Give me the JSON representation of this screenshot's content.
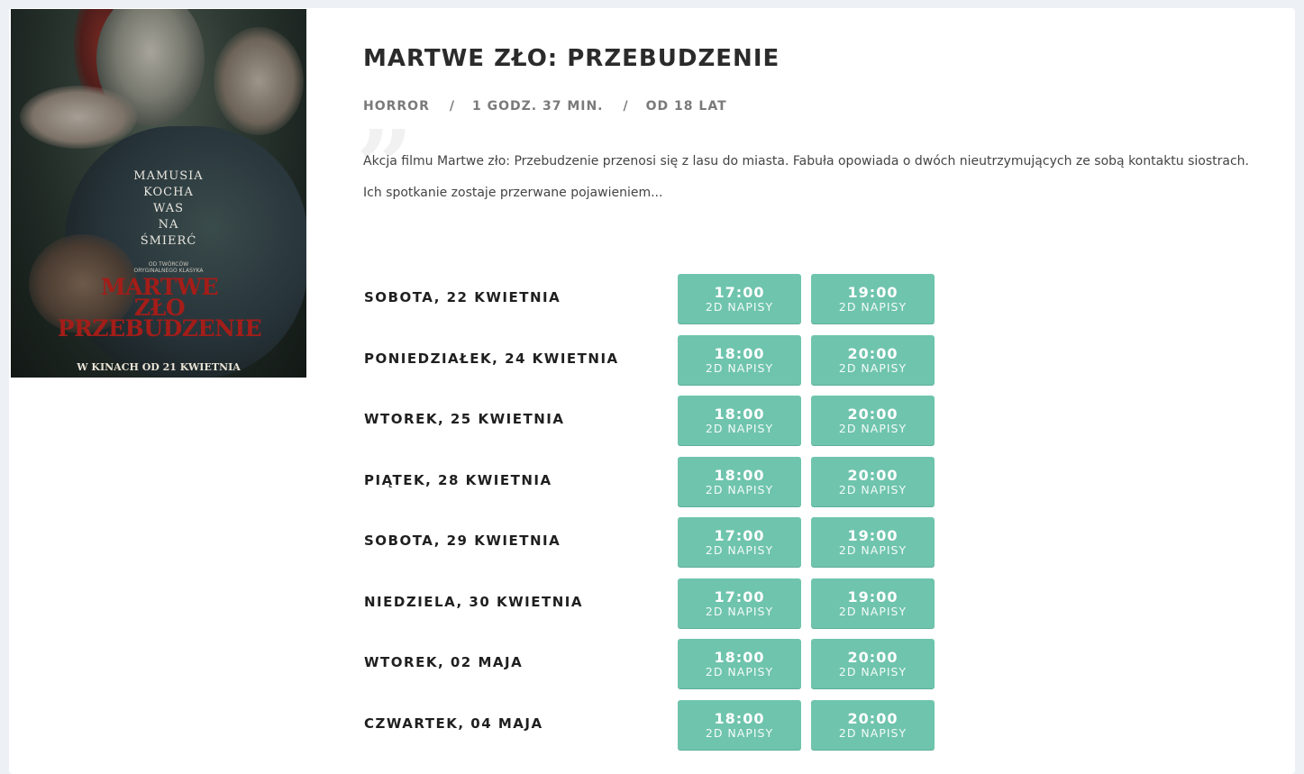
{
  "movie": {
    "title": "MARTWE ZŁO: PRZEBUDZENIE",
    "genre": "HORROR",
    "duration": "1 GODZ. 37 MIN.",
    "age": "OD 18 LAT",
    "separator": "/",
    "quote_mark": "”",
    "description": "Akcja filmu Martwe zło: Przebudzenie przenosi się z lasu do miasta. Fabuła opowiada o dwóch nieutrzymujących ze sobą kontaktu siostrach. Ich spotkanie zostaje przerwane pojawieniem..."
  },
  "poster": {
    "tagline": "MAMUSIA\nKOCHA\nWAS\nNA\nŚMIERĆ",
    "small_text": "OD TWÓRCÓW\nORYGINALNEGO KLASYKA",
    "title": "MARTWE\nZŁO\nPRZEBUDZENIE",
    "release": "W KINACH OD 21 KWIETNIA"
  },
  "colors": {
    "slot_bg": "#6fc4ad",
    "poster_title": "#a31d19"
  },
  "schedule": [
    {
      "day": "SOBOTA, 22 KWIETNIA",
      "slots": [
        {
          "time": "17:00",
          "format": "2D NAPISY"
        },
        {
          "time": "19:00",
          "format": "2D NAPISY"
        }
      ]
    },
    {
      "day": "PONIEDZIAŁEK, 24 KWIETNIA",
      "slots": [
        {
          "time": "18:00",
          "format": "2D NAPISY"
        },
        {
          "time": "20:00",
          "format": "2D NAPISY"
        }
      ]
    },
    {
      "day": "WTOREK, 25 KWIETNIA",
      "slots": [
        {
          "time": "18:00",
          "format": "2D NAPISY"
        },
        {
          "time": "20:00",
          "format": "2D NAPISY"
        }
      ]
    },
    {
      "day": "PIĄTEK, 28 KWIETNIA",
      "slots": [
        {
          "time": "18:00",
          "format": "2D NAPISY"
        },
        {
          "time": "20:00",
          "format": "2D NAPISY"
        }
      ]
    },
    {
      "day": "SOBOTA, 29 KWIETNIA",
      "slots": [
        {
          "time": "17:00",
          "format": "2D NAPISY"
        },
        {
          "time": "19:00",
          "format": "2D NAPISY"
        }
      ]
    },
    {
      "day": "NIEDZIELA, 30 KWIETNIA",
      "slots": [
        {
          "time": "17:00",
          "format": "2D NAPISY"
        },
        {
          "time": "19:00",
          "format": "2D NAPISY"
        }
      ]
    },
    {
      "day": "WTOREK, 02 MAJA",
      "slots": [
        {
          "time": "18:00",
          "format": "2D NAPISY"
        },
        {
          "time": "20:00",
          "format": "2D NAPISY"
        }
      ]
    },
    {
      "day": "CZWARTEK, 04 MAJA",
      "slots": [
        {
          "time": "18:00",
          "format": "2D NAPISY"
        },
        {
          "time": "20:00",
          "format": "2D NAPISY"
        }
      ]
    }
  ]
}
